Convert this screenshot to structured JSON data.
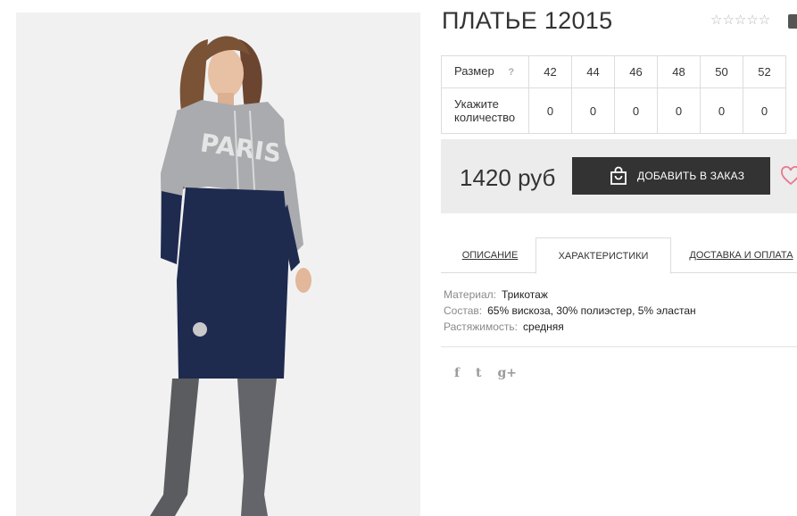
{
  "product": {
    "title": "ПЛАТЬЕ 12015",
    "rating_stars": "☆☆☆☆☆"
  },
  "sizes": {
    "size_label": "Размер",
    "help_mark": "?",
    "qty_label": "Укажите количество",
    "list": [
      "42",
      "44",
      "46",
      "48",
      "50",
      "52"
    ],
    "quantities": [
      "0",
      "0",
      "0",
      "0",
      "0",
      "0"
    ]
  },
  "buy": {
    "price": "1420 руб",
    "add_label": "ДОБАВИТЬ В ЗАКАЗ"
  },
  "tabs": [
    {
      "label": "ОПИСАНИЕ"
    },
    {
      "label": "ХАРАКТЕРИСТИКИ"
    },
    {
      "label": "ДОСТАВКА И ОПЛАТА"
    }
  ],
  "characteristics": [
    {
      "key": "Материал:",
      "value": "Трикотаж"
    },
    {
      "key": "Состав:",
      "value": "65% вискоза, 30% полиэстер, 5% эластан"
    },
    {
      "key": "Растяжимость:",
      "value": "средняя"
    }
  ],
  "social": {
    "facebook": "f",
    "twitter": "t",
    "googleplus": "g+"
  },
  "photo_print": "PARIS",
  "colors": {
    "button": "#333333",
    "buybox": "#ececec",
    "heart": "#e8788e",
    "dress_navy": "#1f2a4f",
    "dress_grey": "#a9abae",
    "boots": "#5a5c5f"
  }
}
